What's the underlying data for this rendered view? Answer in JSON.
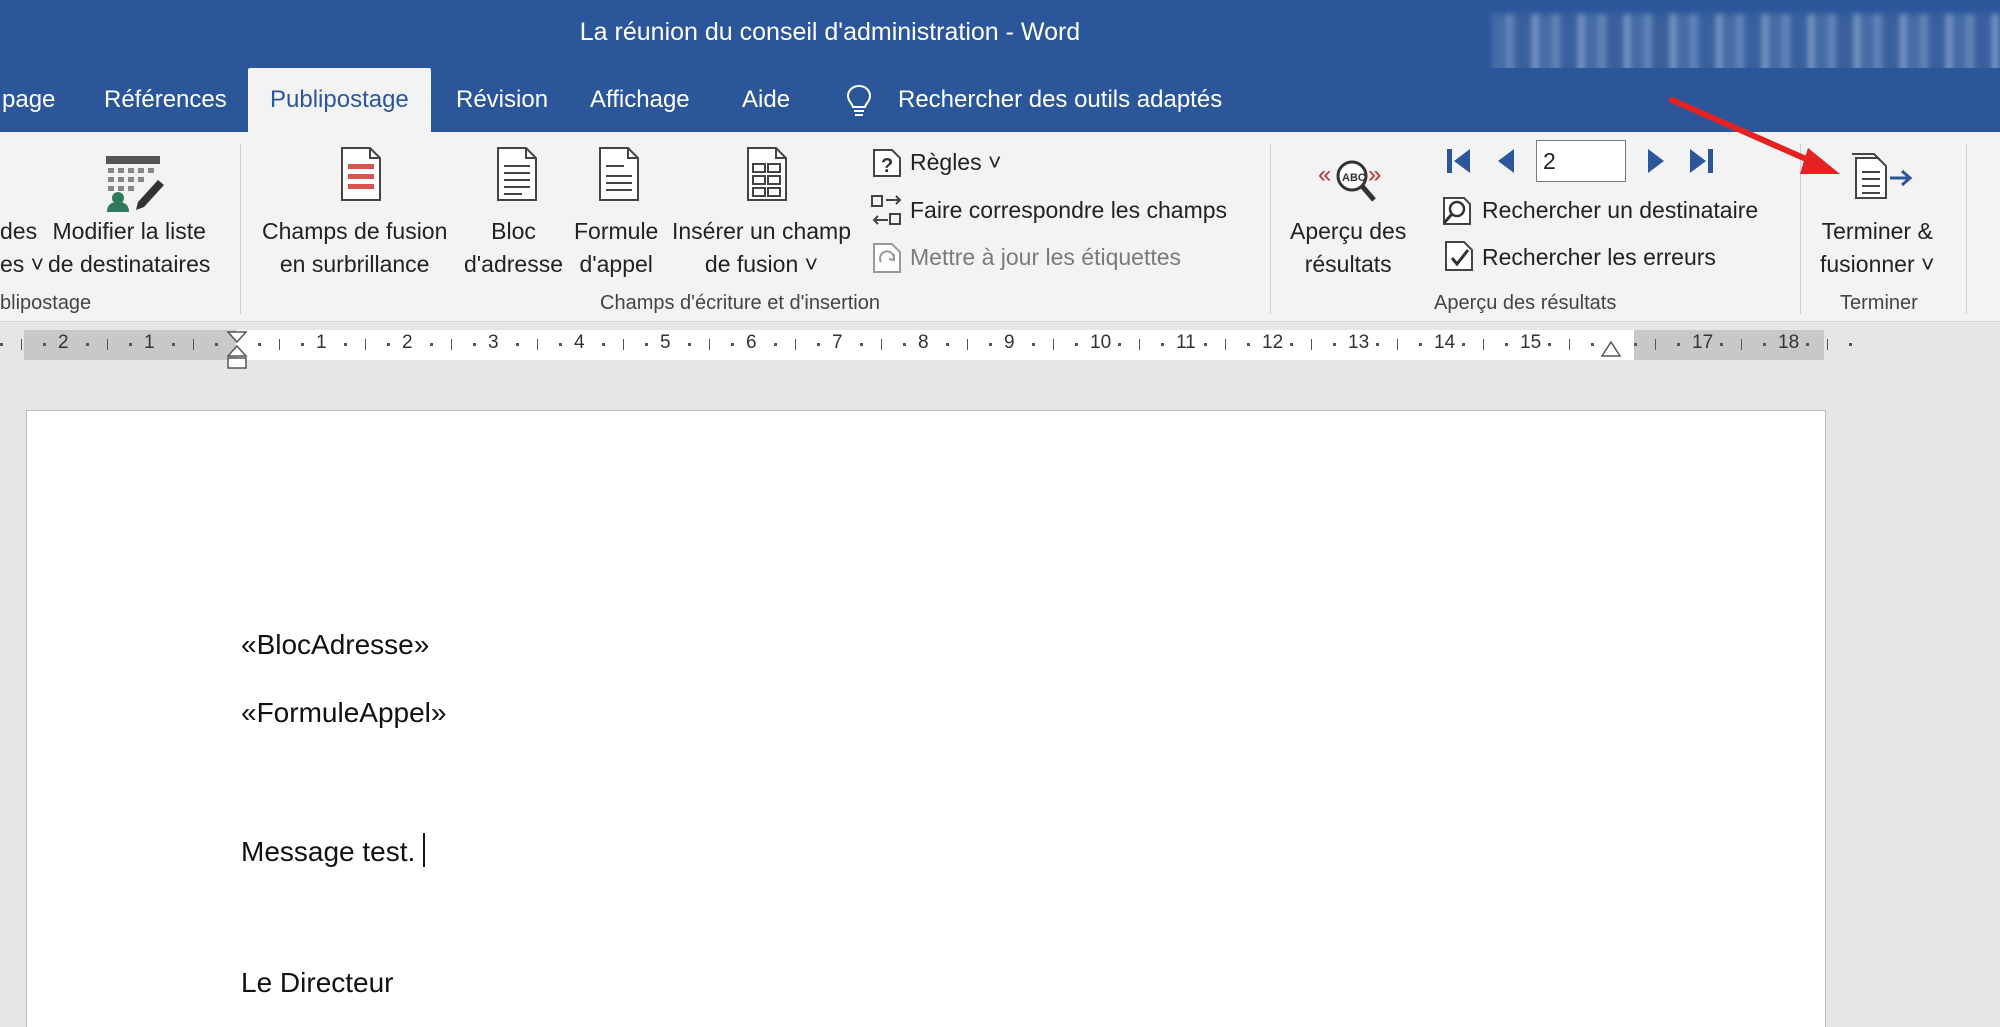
{
  "window": {
    "title": "La réunion du conseil d'administration  -  Word"
  },
  "tabs": {
    "partial_left": "page",
    "references": "Références",
    "mailings": "Publipostage",
    "review": "Révision",
    "view": "Affichage",
    "help": "Aide",
    "tell_me": "Rechercher des outils adaptés"
  },
  "ribbon": {
    "group1": {
      "partial_btn_line1": "des",
      "partial_btn_line2": "es ˅",
      "edit_list_line1": "Modifier la liste",
      "edit_list_line2": "de destinataires",
      "label_partial": "blipostage"
    },
    "group2": {
      "highlight_line1": "Champs de fusion",
      "highlight_line2": "en surbrillance",
      "address_line1": "Bloc",
      "address_line2": "d'adresse",
      "greeting_line1": "Formule",
      "greeting_line2": "d'appel",
      "insert_line1": "Insérer un champ",
      "insert_line2": "de fusion ˅",
      "rules": "Règles ˅",
      "match_fields": "Faire correspondre les champs",
      "update_labels": "Mettre à jour les étiquettes",
      "label": "Champs d'écriture et d'insertion"
    },
    "group3": {
      "preview_line1": "Aperçu des",
      "preview_line2": "résultats",
      "record_number": "2",
      "find_recipient": "Rechercher un destinataire",
      "check_errors": "Rechercher les erreurs",
      "label": "Aperçu des résultats"
    },
    "group4": {
      "finish_line1": "Terminer &",
      "finish_line2": "fusionner ˅",
      "label": "Terminer"
    }
  },
  "ruler": {
    "left_numbers": [
      "2",
      "1"
    ],
    "right_numbers": [
      "1",
      "2",
      "3",
      "4",
      "5",
      "6",
      "7",
      "8",
      "9",
      "10",
      "11",
      "12",
      "13",
      "14",
      "15",
      "17",
      "18"
    ]
  },
  "document": {
    "line1": "«BlocAdresse»",
    "line2": "«FormuleAppel»",
    "line3": "Message test.",
    "line4": "Le Directeur"
  },
  "colors": {
    "word_blue": "#2b579a",
    "ribbon_bg": "#f3f3f3",
    "annotation_red": "#e52222"
  }
}
